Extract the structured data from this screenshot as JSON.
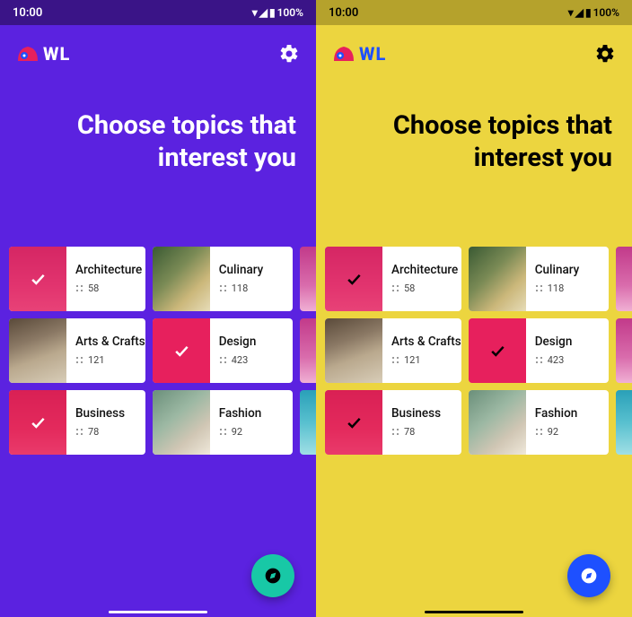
{
  "status": {
    "time": "10:00",
    "battery": "100%"
  },
  "app": {
    "brand": "WL"
  },
  "heading_line1": "Choose topics that",
  "heading_line2": "interest you",
  "topics": {
    "architecture": {
      "label": "Architecture",
      "count": "58"
    },
    "culinary": {
      "label": "Culinary",
      "count": "118"
    },
    "arts_crafts": {
      "label": "Arts & Crafts",
      "count": "121"
    },
    "design": {
      "label": "Design",
      "count": "423"
    },
    "business": {
      "label": "Business",
      "count": "78"
    },
    "fashion": {
      "label": "Fashion",
      "count": "92"
    }
  }
}
